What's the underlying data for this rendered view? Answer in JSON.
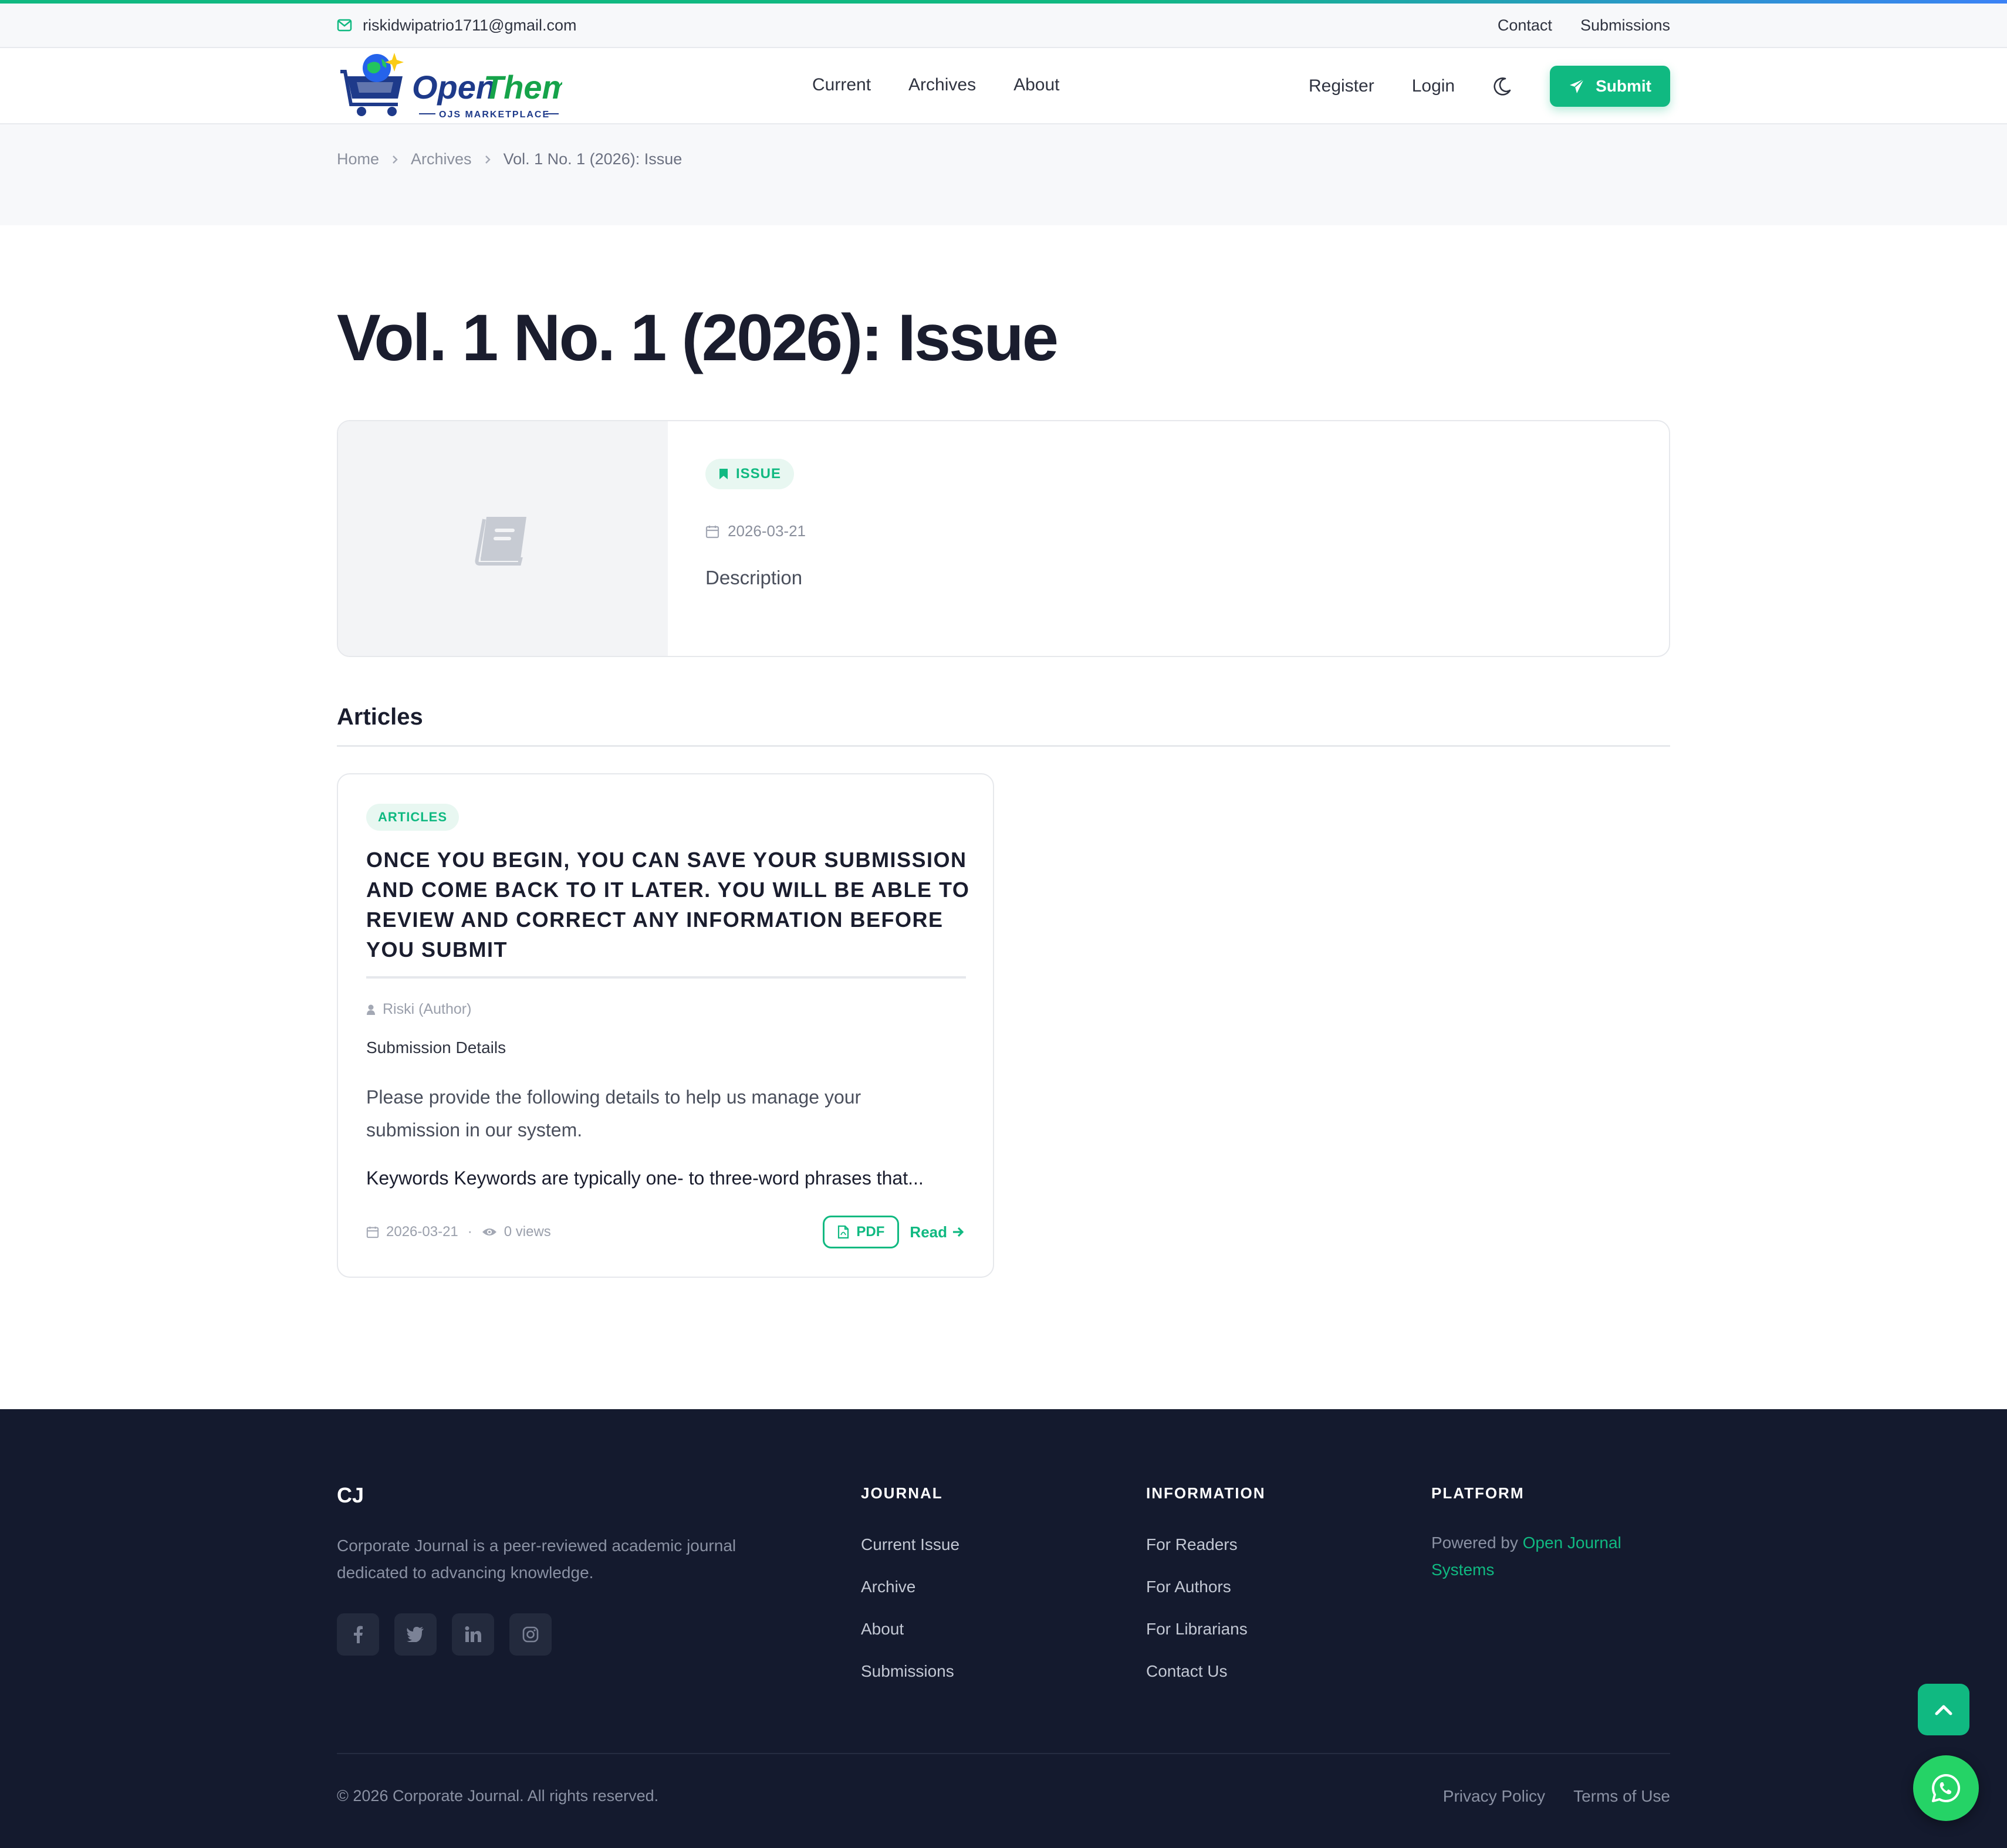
{
  "topbar": {
    "email": "riskidwipatrio1711@gmail.com",
    "links": [
      "Contact",
      "Submissions"
    ]
  },
  "header": {
    "logo_text": "OpenThemes",
    "logo_sub": "OJS MARKETPLACE",
    "nav": [
      "Current",
      "Archives",
      "About"
    ],
    "register": "Register",
    "login": "Login",
    "submit": "Submit"
  },
  "breadcrumb": {
    "home": "Home",
    "archives": "Archives",
    "current": "Vol. 1 No. 1 (2026): Issue"
  },
  "page": {
    "title": "Vol. 1 No. 1 (2026): Issue"
  },
  "issue": {
    "badge": "ISSUE",
    "date": "2026-03-21",
    "description": "Description"
  },
  "articles_section": {
    "title": "Articles",
    "items": [
      {
        "section": "ARTICLES",
        "title": "Once you begin, you can save your submission and come back to it later. You will be able to review and correct any information before you submit",
        "author": "Riski (Author)",
        "subheading": "Submission Details",
        "abstract": "Please provide the following details to help us manage your submission in our system.",
        "keywords": "Keywords Keywords are typically one- to three-word phrases that...",
        "date": "2026-03-21",
        "views": "0 views",
        "pdf": "PDF",
        "read": "Read"
      }
    ]
  },
  "footer": {
    "brand": "CJ",
    "description": "Corporate Journal is a peer-reviewed academic journal dedicated to advancing knowledge.",
    "journal": {
      "heading": "JOURNAL",
      "links": [
        "Current Issue",
        "Archive",
        "About",
        "Submissions"
      ]
    },
    "information": {
      "heading": "INFORMATION",
      "links": [
        "For Readers",
        "For Authors",
        "For Librarians",
        "Contact Us"
      ]
    },
    "platform": {
      "heading": "PLATFORM",
      "powered_prefix": "Powered by ",
      "powered_link": "Open Journal Systems"
    },
    "copyright": "© 2026 Corporate Journal. All rights reserved.",
    "privacy": "Privacy Policy",
    "terms": "Terms of Use"
  },
  "colors": {
    "accent": "#10b981",
    "footer_bg": "#141a2e",
    "title": "#1a1d2e"
  },
  "icons": [
    "mail-icon",
    "moon-icon",
    "paper-plane-icon",
    "chevron-right-icon",
    "bookmark-icon",
    "calendar-icon",
    "book-icon",
    "user-icon",
    "eye-icon",
    "file-pdf-icon",
    "arrow-right-icon",
    "facebook-icon",
    "twitter-icon",
    "linkedin-icon",
    "instagram-icon",
    "chevron-up-icon",
    "whatsapp-icon"
  ]
}
